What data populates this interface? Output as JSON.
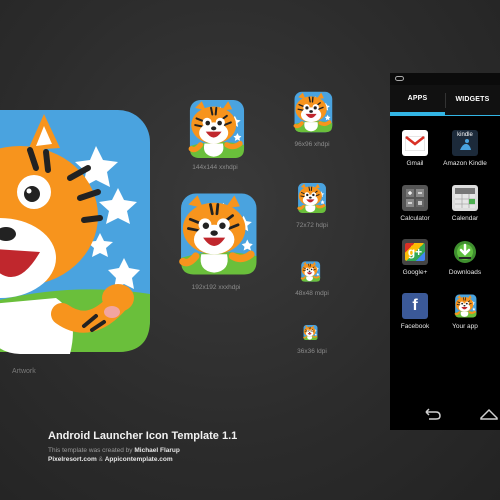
{
  "artwork": {
    "label": "Artwork"
  },
  "icon_sizes": [
    {
      "label": "144x144 xxhdpi"
    },
    {
      "label": "96x96 xhdpi"
    },
    {
      "label": "72x72 hdpi"
    },
    {
      "label": "192x192 xxxhdpi"
    },
    {
      "label": "48x48 mdpi"
    },
    {
      "label": "36x36 ldpi"
    }
  ],
  "footer": {
    "title": "Android Launcher Icon Template 1.1",
    "credit_prefix": "This template was created by ",
    "author": "Michael Flarup",
    "sites_a": "Pixelresort.com",
    "sites_and": " & ",
    "sites_b": "Appicontemplate.com"
  },
  "phone": {
    "tabs": [
      {
        "label": "APPS"
      },
      {
        "label": "WIDGETS"
      }
    ],
    "apps": [
      {
        "label": "Gmail",
        "icon": "gmail-icon"
      },
      {
        "label": "Amazon Kindle",
        "icon": "kindle-icon",
        "icon_text": "kindle"
      },
      {
        "label": "Calculator",
        "icon": "calculator-icon"
      },
      {
        "label": "Calendar",
        "icon": "calendar-icon"
      },
      {
        "label": "Google+",
        "icon": "google-plus-icon",
        "icon_text": "g+"
      },
      {
        "label": "Downloads",
        "icon": "downloads-icon"
      },
      {
        "label": "Facebook",
        "icon": "facebook-icon",
        "icon_text": "f"
      },
      {
        "label": "Your app",
        "icon": "tiger-app-icon"
      }
    ]
  },
  "colors": {
    "accent": "#33b5e5",
    "tiger_orange": "#f7941d",
    "sky_blue": "#4aa3df",
    "grass_green": "#6abf3b"
  }
}
